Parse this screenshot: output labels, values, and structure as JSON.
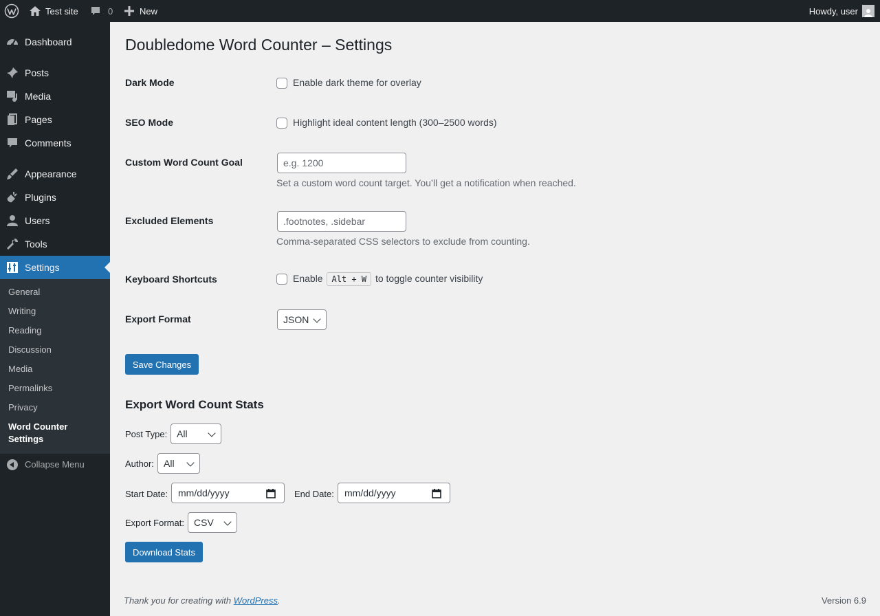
{
  "adminbar": {
    "site_name": "Test site",
    "comment_count": "0",
    "new_label": "New",
    "howdy": "Howdy, user"
  },
  "sidebar": {
    "items": [
      {
        "label": "Dashboard",
        "icon": "dashboard-icon"
      },
      {
        "label": "Posts",
        "icon": "pin-icon"
      },
      {
        "label": "Media",
        "icon": "media-icon"
      },
      {
        "label": "Pages",
        "icon": "pages-icon"
      },
      {
        "label": "Comments",
        "icon": "comment-icon"
      },
      {
        "label": "Appearance",
        "icon": "brush-icon"
      },
      {
        "label": "Plugins",
        "icon": "plug-icon"
      },
      {
        "label": "Users",
        "icon": "user-icon"
      },
      {
        "label": "Tools",
        "icon": "wrench-icon"
      },
      {
        "label": "Settings",
        "icon": "settings-icon",
        "current": true
      }
    ],
    "submenu": [
      "General",
      "Writing",
      "Reading",
      "Discussion",
      "Media",
      "Permalinks",
      "Privacy"
    ],
    "submenu_current": "Word Counter Settings",
    "collapse_label": "Collapse Menu"
  },
  "page": {
    "title": "Doubledome Word Counter – Settings",
    "dark_mode": {
      "label": "Dark Mode",
      "checkbox_text": "Enable dark theme for overlay",
      "checked": false
    },
    "seo_mode": {
      "label": "SEO Mode",
      "checkbox_text": "Highlight ideal content length (300–2500 words)",
      "checked": false
    },
    "goal": {
      "label": "Custom Word Count Goal",
      "placeholder": "e.g. 1200",
      "value": "",
      "description": "Set a custom word count target. You’ll get a notification when reached."
    },
    "excluded": {
      "label": "Excluded Elements",
      "placeholder": ".footnotes, .sidebar",
      "value": "",
      "description": "Comma-separated CSS selectors to exclude from counting."
    },
    "shortcuts": {
      "label": "Keyboard Shortcuts",
      "text_before": "Enable",
      "kbd": "Alt + W",
      "text_after": "to toggle counter visibility",
      "checked": false
    },
    "export_format": {
      "label": "Export Format",
      "selected": "JSON"
    },
    "save_label": "Save Changes"
  },
  "stats": {
    "title": "Export Word Count Stats",
    "post_type": {
      "label": "Post Type:",
      "selected": "All"
    },
    "author": {
      "label": "Author:",
      "selected": "All"
    },
    "start_date": {
      "label": "Start Date:",
      "placeholder": "mm/dd/yyyy"
    },
    "end_date": {
      "label": "End Date:",
      "placeholder": "mm/dd/yyyy"
    },
    "export_format": {
      "label": "Export Format:",
      "selected": "CSV"
    },
    "download_label": "Download Stats"
  },
  "footer": {
    "thanks_prefix": "Thank you for creating with ",
    "link_text": "WordPress",
    "thanks_suffix": ".",
    "version": "Version 6.9"
  },
  "colors": {
    "accent": "#2271b1",
    "sidebar": "#1d2327",
    "submenu": "#2c3338",
    "background": "#f0f0f1"
  }
}
